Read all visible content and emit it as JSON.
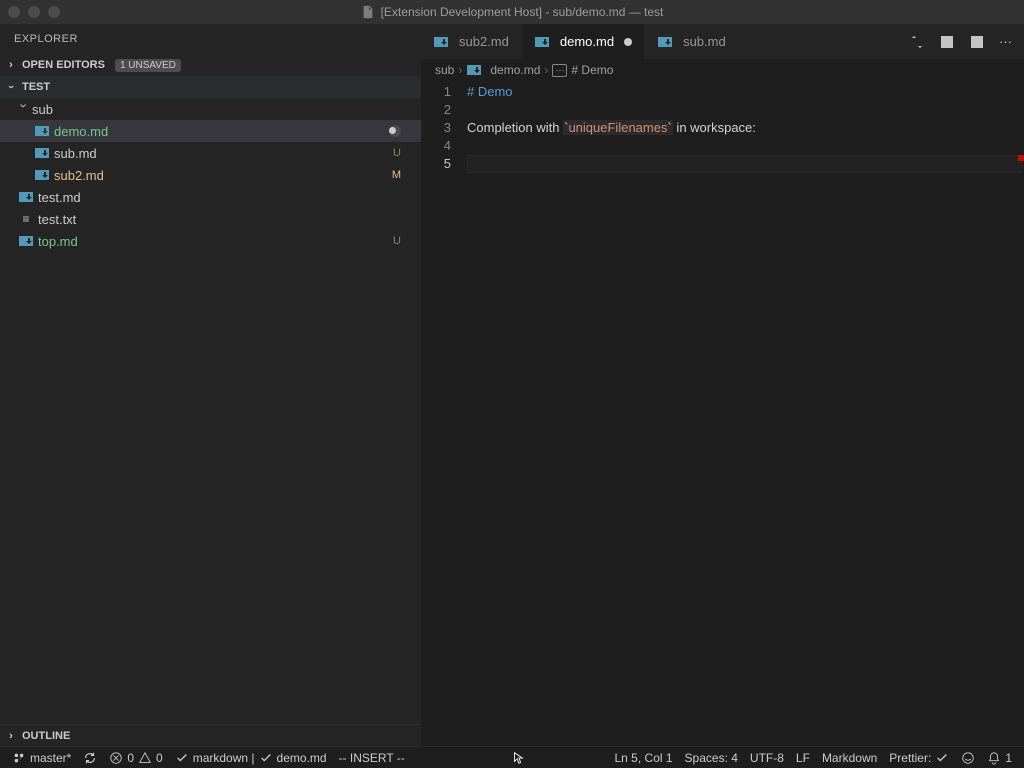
{
  "window": {
    "title": "[Extension Development Host] - sub/demo.md — test"
  },
  "explorer": {
    "title": "EXPLORER",
    "openEditors": {
      "label": "OPEN EDITORS",
      "unsaved": "1 UNSAVED"
    },
    "root": "TEST",
    "folder": "sub",
    "items": [
      {
        "name": "demo.md",
        "status": "dot",
        "cls": "unt"
      },
      {
        "name": "sub.md",
        "status": "U",
        "cls": "unt"
      },
      {
        "name": "sub2.md",
        "status": "M",
        "cls": "mod"
      }
    ],
    "rootItems": [
      {
        "name": "test.md",
        "status": "",
        "cls": "",
        "type": "md"
      },
      {
        "name": "test.txt",
        "status": "",
        "cls": "",
        "type": "txt"
      },
      {
        "name": "top.md",
        "status": "U",
        "cls": "unt",
        "type": "md"
      }
    ],
    "outline": "OUTLINE"
  },
  "tabs": [
    {
      "label": "sub2.md",
      "active": false,
      "modified": false
    },
    {
      "label": "demo.md",
      "active": true,
      "modified": true
    },
    {
      "label": "sub.md",
      "active": false,
      "modified": false
    }
  ],
  "breadcrumb": {
    "a": "sub",
    "b": "demo.md",
    "c": "# Demo"
  },
  "code": {
    "lineNumbers": [
      "1",
      "2",
      "3",
      "4",
      "5"
    ],
    "header": "# Demo",
    "l3a": "Completion with ",
    "l3tick": "`",
    "l3code": "uniqueFilenames",
    "l3b": " in workspace:"
  },
  "status": {
    "branch": "master*",
    "sync": "",
    "err": "0",
    "warn": "0",
    "checks1": "markdown |",
    "checks2": "demo.md",
    "mode": "-- INSERT --",
    "ln": "Ln 5, Col 1",
    "spaces": "Spaces: 4",
    "enc": "UTF-8",
    "eol": "LF",
    "lang": "Markdown",
    "prettier": "Prettier:",
    "bell": "1"
  }
}
